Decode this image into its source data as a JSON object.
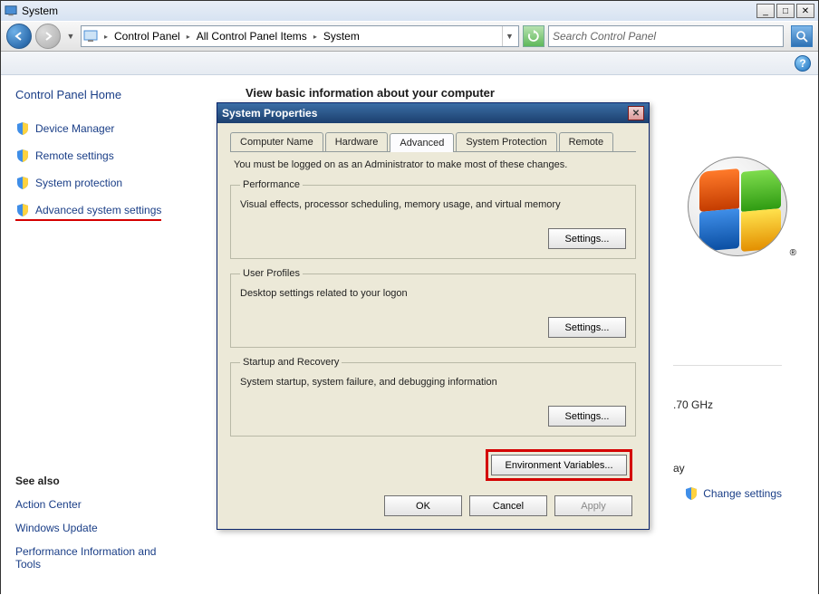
{
  "window": {
    "title": "System"
  },
  "nav": {
    "address": [
      "Control Panel",
      "All Control Panel Items",
      "System"
    ],
    "search_placeholder": "Search Control Panel"
  },
  "sidebar": {
    "home": "Control Panel Home",
    "links": [
      {
        "label": "Device Manager"
      },
      {
        "label": "Remote settings"
      },
      {
        "label": "System protection"
      },
      {
        "label": "Advanced system settings",
        "highlighted": true
      }
    ],
    "see_also_title": "See also",
    "see_also": [
      "Action Center",
      "Windows Update",
      "Performance Information and Tools"
    ]
  },
  "main": {
    "heading": "View basic information about your computer",
    "ghz": ".70 GHz",
    "ay": "ay",
    "change_settings": "Change settings"
  },
  "dialog": {
    "title": "System Properties",
    "tabs": [
      "Computer Name",
      "Hardware",
      "Advanced",
      "System Protection",
      "Remote"
    ],
    "active_tab": 2,
    "admin_note": "You must be logged on as an Administrator to make most of these changes.",
    "groups": {
      "performance": {
        "legend": "Performance",
        "desc": "Visual effects, processor scheduling, memory usage, and virtual memory",
        "button": "Settings..."
      },
      "profiles": {
        "legend": "User Profiles",
        "desc": "Desktop settings related to your logon",
        "button": "Settings..."
      },
      "startup": {
        "legend": "Startup and Recovery",
        "desc": "System startup, system failure, and debugging information",
        "button": "Settings..."
      }
    },
    "env_button": "Environment Variables...",
    "buttons": {
      "ok": "OK",
      "cancel": "Cancel",
      "apply": "Apply"
    }
  }
}
